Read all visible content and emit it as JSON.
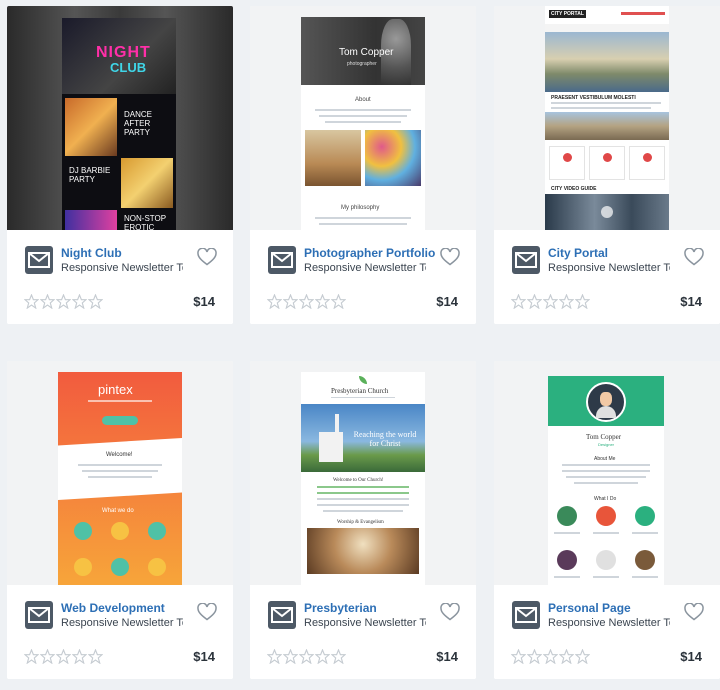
{
  "cards": [
    {
      "title": "Night Club",
      "subtitle": "Responsive Newsletter Template",
      "price": "$14",
      "rating": 0,
      "preview": {
        "line1": "NIGHT",
        "line2": "CLUB",
        "text1": "DANCE AFTER PARTY",
        "text2": "DJ BARBIE PARTY",
        "text3": "NON-STOP EROTIC"
      }
    },
    {
      "title": "Photographer Portfolio",
      "subtitle": "Responsive Newsletter Template",
      "price": "$14",
      "rating": 0,
      "preview": {
        "name": "Tom Copper",
        "role": "photographer",
        "about": "About",
        "philosophy": "My philosophy"
      }
    },
    {
      "title": "City Portal",
      "subtitle": "Responsive Newsletter Template",
      "price": "$14",
      "rating": 0,
      "preview": {
        "logo": "CITY PORTAL",
        "heading": "PRAESENT VESTIBULUM MOLESTI",
        "section": "CITY VIDEO GUIDE"
      }
    },
    {
      "title": "Web Development",
      "subtitle": "Responsive Newsletter Template",
      "price": "$14",
      "rating": 0,
      "preview": {
        "logo": "pintex",
        "welcome": "Welcome!",
        "what": "What we do"
      }
    },
    {
      "title": "Presbyterian",
      "subtitle": "Responsive Newsletter Template",
      "price": "$14",
      "rating": 0,
      "preview": {
        "logo": "Presbyterian Church",
        "tagline": "Reaching the world for Christ",
        "welcome": "Welcome to Our Church!",
        "worship": "Worship & Evangelism"
      }
    },
    {
      "title": "Personal Page",
      "subtitle": "Responsive Newsletter Template",
      "price": "$14",
      "rating": 0,
      "preview": {
        "name": "Tom Copper",
        "role": "Designer",
        "about": "About Me",
        "whatido": "What I Do"
      }
    }
  ]
}
